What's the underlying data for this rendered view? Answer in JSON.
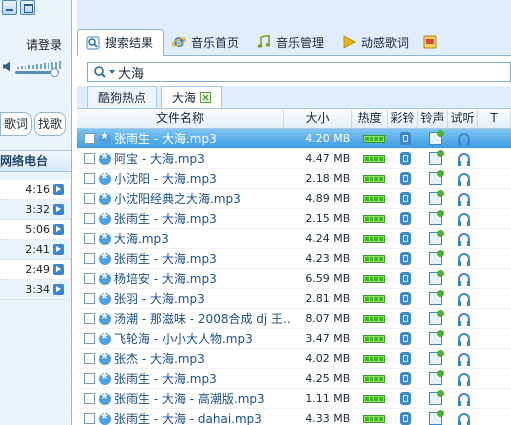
{
  "left": {
    "login_label": "请登录",
    "tabs": [
      "歌词",
      "找歌"
    ],
    "radio_header": "网络电台",
    "durations": [
      "4:16",
      "3:32",
      "5:06",
      "2:41",
      "2:49",
      "3:34"
    ]
  },
  "nav": {
    "tabs": [
      {
        "label": "搜索结果",
        "icon": "search-icon"
      },
      {
        "label": "音乐首页",
        "icon": "ie-globe-icon"
      },
      {
        "label": "音乐管理",
        "icon": "music-note-icon"
      },
      {
        "label": "动感歌词",
        "icon": "play-arrow-icon"
      }
    ]
  },
  "search": {
    "value": "大海"
  },
  "subtabs": [
    "酷狗热点",
    "大海"
  ],
  "table": {
    "headers": {
      "name": "文件名称",
      "size": "大小",
      "hot": "热度",
      "ring": "彩铃",
      "ringtone": "铃声",
      "listen": "试听",
      "more": "T"
    },
    "rows": [
      {
        "name": "张雨生 - 大海.mp3",
        "size": "4.20 MB"
      },
      {
        "name": "阿宝 - 大海.mp3",
        "size": "4.47 MB"
      },
      {
        "name": "小沈阳 - 大海.mp3",
        "size": "2.18 MB"
      },
      {
        "name": "小沈阳经典之大海.mp3",
        "size": "4.89 MB"
      },
      {
        "name": "张雨生 - 大海.mp3",
        "size": "2.15 MB"
      },
      {
        "name": "大海.mp3",
        "size": "4.24 MB"
      },
      {
        "name": "张雨生 - 大海.mp3",
        "size": "4.23 MB"
      },
      {
        "name": "杨培安 - 大海.mp3",
        "size": "6.59 MB"
      },
      {
        "name": "张羽 - 大海.mp3",
        "size": "2.81 MB"
      },
      {
        "name": "汤潮 - 那滋味 - 2008合成 dj 王...",
        "size": "8.07 MB"
      },
      {
        "name": "飞轮海 - 小小大人物.mp3",
        "size": "3.47 MB"
      },
      {
        "name": "张杰 - 大海.mp3",
        "size": "4.02 MB"
      },
      {
        "name": "张雨生 - 大海.mp3",
        "size": "4.25 MB"
      },
      {
        "name": "张雨生 - 大海 - 高潮版.mp3",
        "size": "1.11 MB"
      },
      {
        "name": "张雨生 - 大海 - dahai.mp3",
        "size": "4.33 MB"
      }
    ]
  }
}
